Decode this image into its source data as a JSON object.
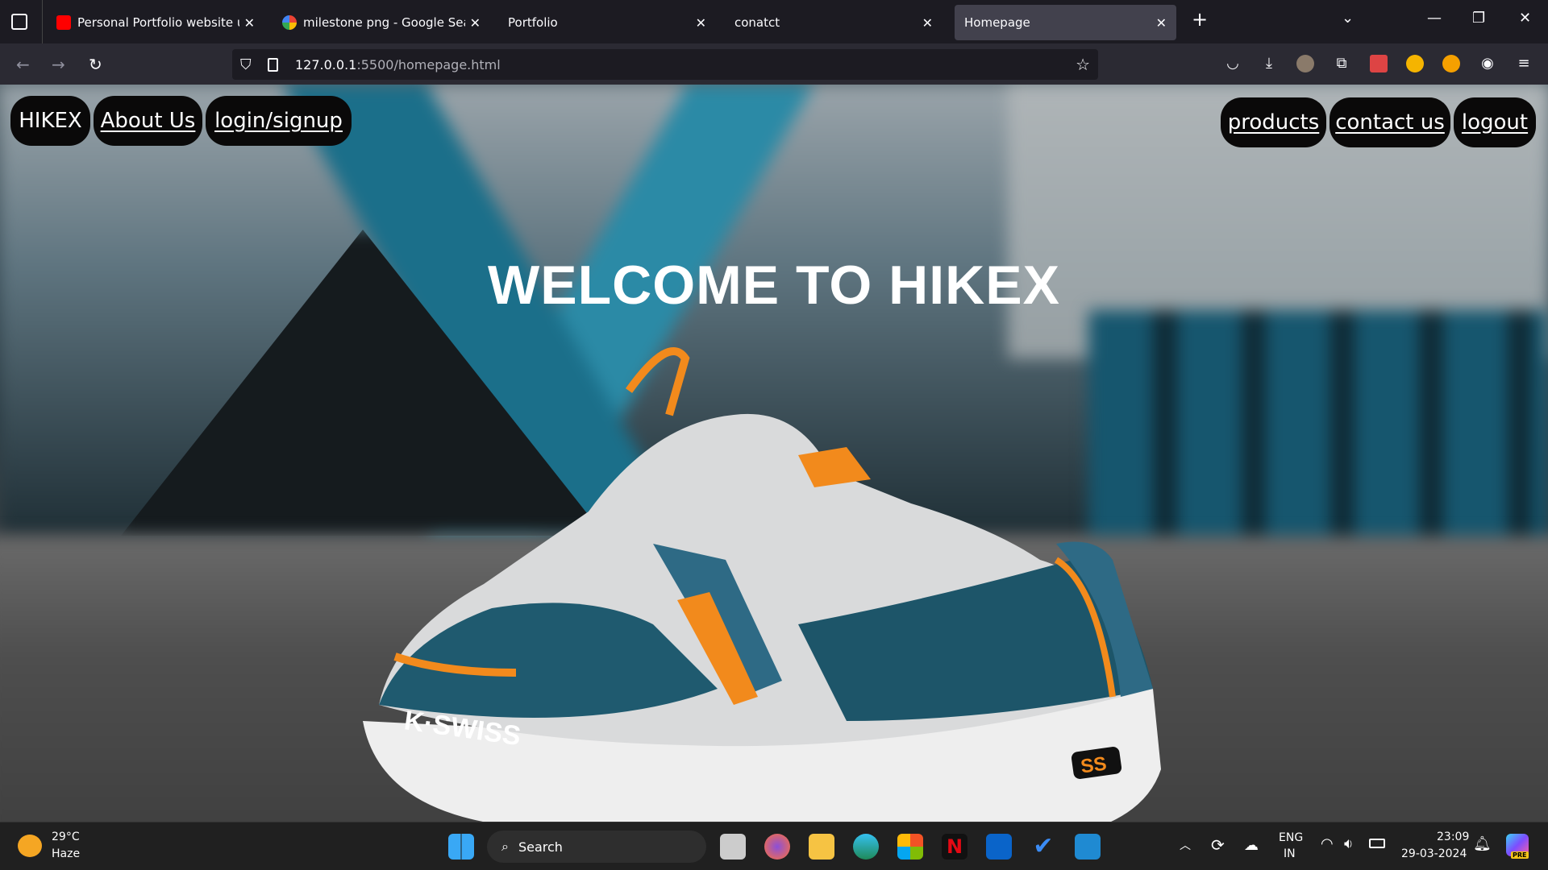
{
  "browser": {
    "tabs": [
      {
        "title": "Personal Portfolio website using",
        "icon": "youtube-icon",
        "active": false
      },
      {
        "title": "milestone png - Google Search",
        "icon": "google-icon",
        "active": false
      },
      {
        "title": "Portfolio",
        "icon": "",
        "active": false
      },
      {
        "title": "conatct",
        "icon": "",
        "active": false
      },
      {
        "title": "Homepage",
        "icon": "",
        "active": true
      }
    ],
    "url_host": "127.0.0.1",
    "url_rest": ":5500/homepage.html"
  },
  "page": {
    "nav_left": [
      {
        "label": "HIKEX",
        "link": false
      },
      {
        "label": "About Us",
        "link": true
      },
      {
        "label": "login/signup",
        "link": true
      }
    ],
    "nav_right": [
      {
        "label": "products"
      },
      {
        "label": "contact us"
      },
      {
        "label": "logout"
      }
    ],
    "title": "WELCOME TO HIKEX",
    "shoe_brand": "K·SWISS",
    "shoe_badge": "SS"
  },
  "taskbar": {
    "weather_temp": "29°C",
    "weather_desc": "Haze",
    "search_placeholder": "Search",
    "lang_1": "ENG",
    "lang_2": "IN",
    "time": "23:09",
    "date": "29-03-2024",
    "copilot_badge": "PRE"
  },
  "colors": {
    "accent_orange": "#f28a1c",
    "shoe_teal": "#2e6a85",
    "pill_bg": "#0a0909"
  }
}
